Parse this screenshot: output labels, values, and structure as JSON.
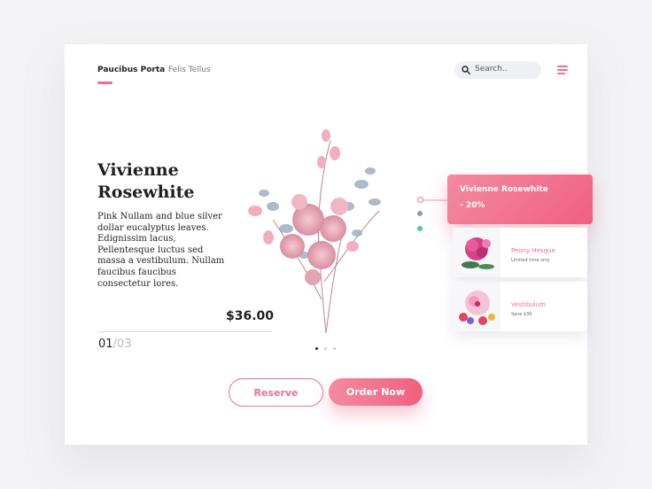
{
  "nav": {
    "items": [
      {
        "label": "Paucibus Porta",
        "active": true
      },
      {
        "label": "Felis Tellus",
        "active": false
      }
    ]
  },
  "search": {
    "placeholder": "Search.."
  },
  "hero": {
    "title_line1": "Vivienne",
    "title_line2": "Rosewhite",
    "description": "Pink Nullam and blue silver dollar eucalyptus leaves. Edignissim lacus, Pellentesque luctus sed massa a vestibulum. Nullam faucibus faucibus consectetur lores.",
    "price": "$36.00",
    "page_current": "01",
    "page_total": "/03"
  },
  "carousel": {
    "count": 3,
    "active_index": 0
  },
  "promo": {
    "name": "Vivienne Rosewhite",
    "discount": "- 20%"
  },
  "products": [
    {
      "name": "Peony Hesque",
      "meta": "Limited time only"
    },
    {
      "name": "Vestibulum",
      "meta": "Save $30"
    }
  ],
  "actions": {
    "reserve_label": "Reserve",
    "order_label": "Order Now"
  },
  "colors": {
    "accent": "#f06f8c",
    "side_dot_1": "#f06f8c",
    "side_dot_2": "#8e9aa8",
    "side_dot_3": "#4cc9a4"
  },
  "icons": {
    "search": "search-icon",
    "menu": "hamburger-menu-icon"
  }
}
